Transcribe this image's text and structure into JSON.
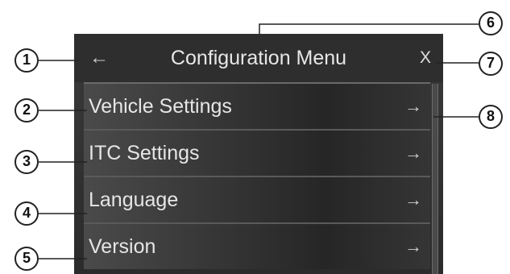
{
  "header": {
    "title": "Configuration Menu",
    "back_glyph": "←",
    "close_label": "X"
  },
  "menu": {
    "items": [
      {
        "label": "Vehicle Settings",
        "arrow": "→"
      },
      {
        "label": "ITC Settings",
        "arrow": "→"
      },
      {
        "label": "Language",
        "arrow": "→"
      },
      {
        "label": "Version",
        "arrow": "→"
      }
    ]
  },
  "callouts": [
    "1",
    "2",
    "3",
    "4",
    "5",
    "6",
    "7",
    "8"
  ],
  "icons": {
    "back": "back-arrow-icon",
    "close": "close-icon",
    "item_arrow": "arrow-right-icon"
  },
  "colors": {
    "screen_background": "#2b2b2b",
    "text": "#e6e6e6"
  }
}
